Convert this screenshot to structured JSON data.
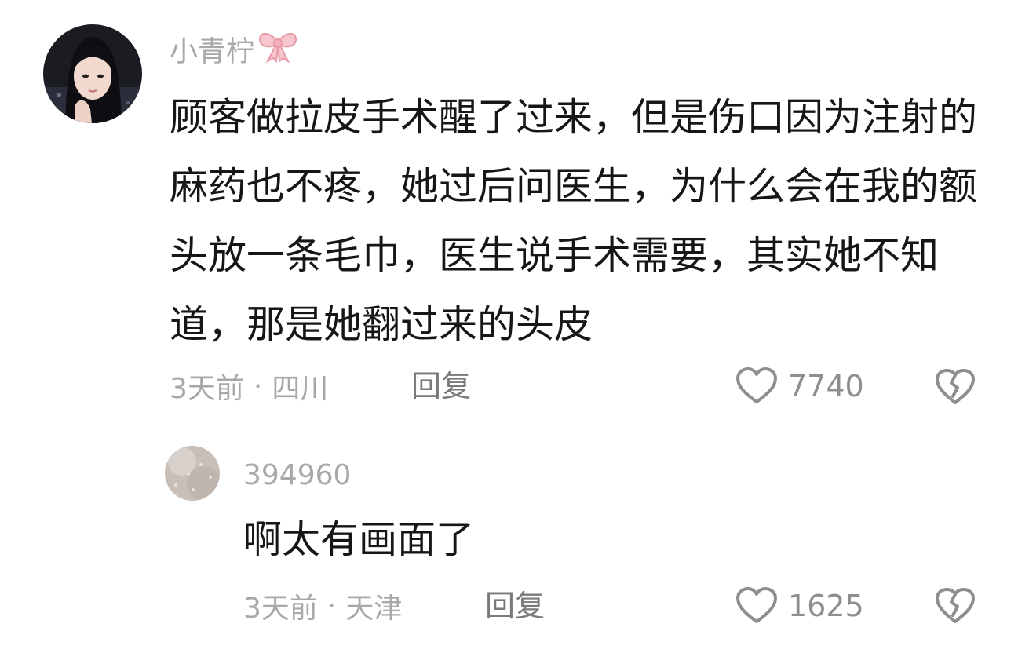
{
  "comments": [
    {
      "username": "小青柠",
      "username_emoji": "🎀",
      "text": "顾客做拉皮手术醒了过来，但是伤口因为注射的麻药也不疼，她过后问医生，为什么会在我的额头放一条毛巾，医生说手术需要，其实她不知道，那是她翻过来的头皮",
      "time": "3天前",
      "separator": "·",
      "location": "四川",
      "reply_label": "回复",
      "like_count": "7740"
    },
    {
      "username": "394960",
      "text": "啊太有画面了",
      "time": "3天前",
      "separator": "·",
      "location": "天津",
      "reply_label": "回复",
      "like_count": "1625"
    }
  ],
  "colors": {
    "text": "#161616",
    "muted": "#a8a8a8",
    "reply": "#7a7a7a",
    "icon": "#8e8e8e",
    "bow": "#f4b6c2"
  },
  "icons": {
    "like": "heart-outline-icon",
    "dislike": "broken-heart-icon"
  }
}
